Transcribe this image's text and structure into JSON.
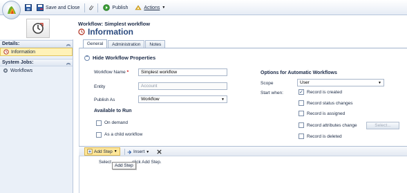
{
  "toolbar": {
    "save_close": "Save and Close",
    "publish": "Publish",
    "actions": "Actions"
  },
  "header": {
    "workflow_label": "Workflow: Simplest workflow",
    "form_title": "Information"
  },
  "nav": {
    "details_head": "Details:",
    "details_items": [
      {
        "label": "Information"
      }
    ],
    "system_jobs_head": "System Jobs:",
    "system_jobs_items": [
      {
        "label": "Workflows"
      }
    ]
  },
  "tabs": [
    {
      "label": "General"
    },
    {
      "label": "Administration"
    },
    {
      "label": "Notes"
    }
  ],
  "section": {
    "title": "Hide Workflow Properties"
  },
  "form": {
    "workflow_name_label": "Workflow Name",
    "workflow_name_required": "*",
    "workflow_name_value": "Simplest workflow",
    "entity_label": "Entity",
    "entity_value": "Account",
    "publish_as_label": "Publish As",
    "publish_as_value": "Workflow",
    "available_head": "Available to Run",
    "on_demand": "On demand",
    "child_workflow": "As a child workflow"
  },
  "options": {
    "head": "Options for Automatic Workflows",
    "scope_label": "Scope",
    "scope_value": "User",
    "start_when_label": "Start when:",
    "record_created": "Record is created",
    "record_status": "Record status changes",
    "record_assigned": "Record is assigned",
    "record_attributes": "Record attributes change",
    "select_button": "Select...",
    "record_deleted": "Record is deleted",
    "checked": {
      "record_created": true
    }
  },
  "steps": {
    "add_step": "Add Step",
    "insert": "Insert",
    "hint": "Select  this row and click Add Step.",
    "hint_visible_prefix": "Select",
    "hint_visible_suffix": "click Add Step.",
    "tooltip": "Add Step"
  }
}
